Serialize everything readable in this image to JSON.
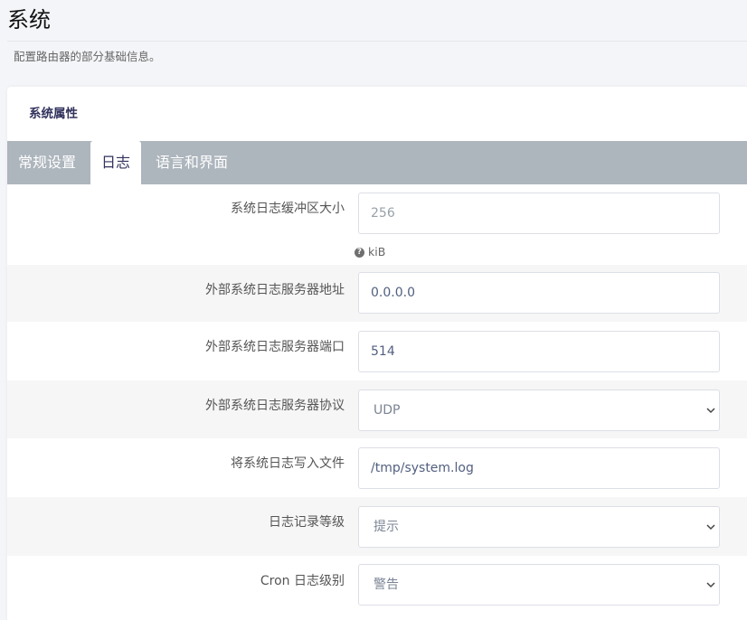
{
  "page": {
    "title": "系统",
    "description": "配置路由器的部分基础信息。"
  },
  "section": {
    "title": "系统属性"
  },
  "tabs": [
    {
      "label": "常规设置",
      "active": false
    },
    {
      "label": "日志",
      "active": true
    },
    {
      "label": "语言和界面",
      "active": false
    }
  ],
  "fields": [
    {
      "label": "系统日志缓冲区大小",
      "type": "input",
      "value": "",
      "placeholder": "256",
      "help": "kiB",
      "help_icon": "question-circle-icon"
    },
    {
      "label": "外部系统日志服务器地址",
      "type": "input",
      "value": "0.0.0.0"
    },
    {
      "label": "外部系统日志服务器端口",
      "type": "input",
      "value": "514"
    },
    {
      "label": "外部系统日志服务器协议",
      "type": "select",
      "value": "UDP",
      "icon": "chevron-down-icon"
    },
    {
      "label": "将系统日志写入文件",
      "type": "input",
      "value": "/tmp/system.log"
    },
    {
      "label": "日志记录等级",
      "type": "select",
      "value": "提示",
      "icon": "chevron-down-icon"
    },
    {
      "label": "Cron 日志级别",
      "type": "select",
      "value": "警告",
      "icon": "chevron-down-icon"
    }
  ],
  "theme": {
    "tab_bar_bg": "#adb5bd",
    "row_alt_bg": "#f6f6f6",
    "active_tab_bg": "#ffffff"
  }
}
